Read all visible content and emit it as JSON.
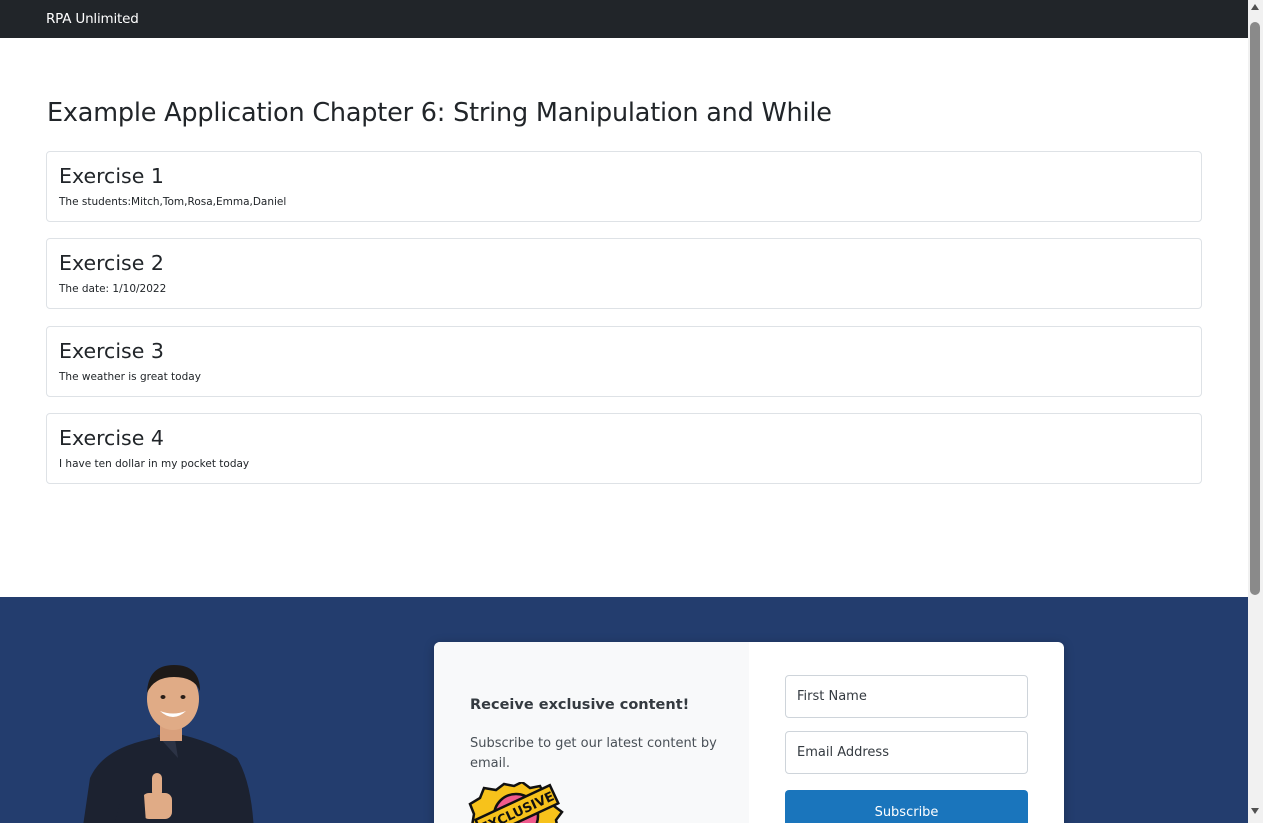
{
  "navbar": {
    "brand": "RPA Unlimited"
  },
  "main": {
    "title": "Example Application Chapter 6: String Manipulation and While",
    "cards": [
      {
        "title": "Exercise 1",
        "text": "The students:Mitch,Tom,Rosa,Emma,Daniel"
      },
      {
        "title": "Exercise 2",
        "text": "The date: 1/10/2022"
      },
      {
        "title": "Exercise 3",
        "text": "The weather is great today"
      },
      {
        "title": "Exercise 4",
        "text": "I have ten dollar in my pocket today"
      }
    ]
  },
  "footer": {
    "heading": "Receive exclusive content!",
    "text": "Subscribe to get our latest content by email.",
    "badge_text": "EXCLUSIVE",
    "first_name_placeholder": "First Name",
    "email_placeholder": "Email Address",
    "subscribe_label": "Subscribe"
  },
  "colors": {
    "navbar_bg": "#212529",
    "footer_bg": "#233d6e",
    "button_bg": "#1a75bc"
  },
  "icons": [
    "person-photo",
    "exclusive-badge-icon",
    "scroll-up-arrow-icon",
    "scroll-down-arrow-icon"
  ]
}
